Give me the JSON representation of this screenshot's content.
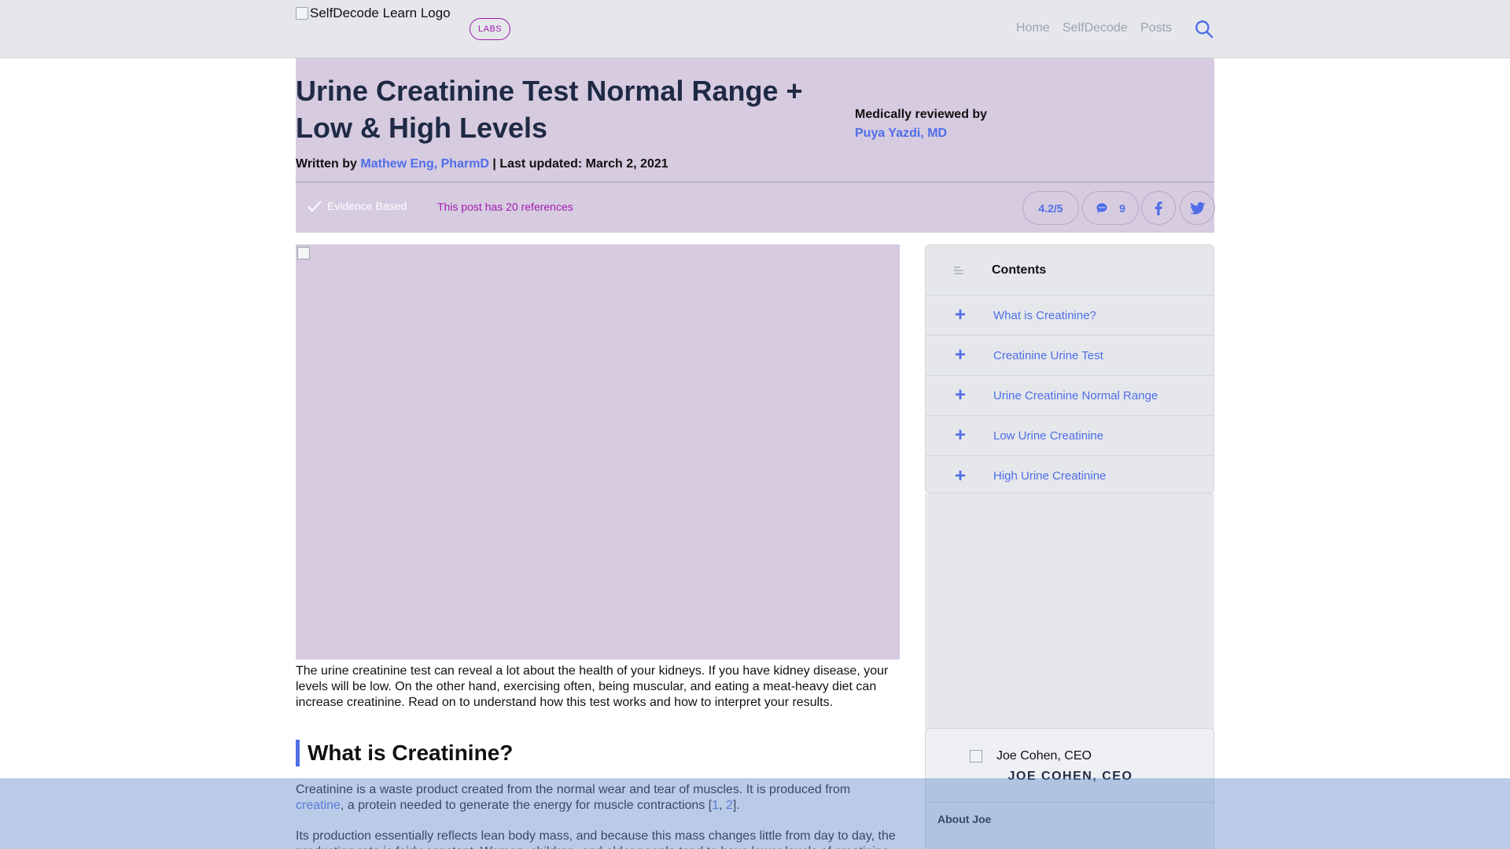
{
  "header": {
    "logo_alt": "SelfDecode Learn Logo",
    "badge": "LABS",
    "nav": [
      "Home",
      "SelfDecode",
      "Posts"
    ]
  },
  "article": {
    "title": "Urine Creatinine Test Normal Range + Low & High Levels",
    "written_by_label": "Written by",
    "author": "Mathew Eng, PharmD",
    "updated": "| Last updated: March 2, 2021",
    "reviewed_label": "Medically reviewed by",
    "reviewer": "Puya Yazdi, MD",
    "evidence": "Evidence Based",
    "references": "This post has 20 references",
    "rating": "4.2/5",
    "comments": "9",
    "intro": "The urine creatinine test can reveal a lot about the health of your kidneys. If you have kidney disease, your levels will be low. On the other hand, exercising often, being muscular, and eating a meat-heavy diet can increase creatinine. Read on to understand how this test works and how to interpret your results.",
    "section_title": "What is Creatinine?",
    "para1_a": "Creatinine is a waste product created from the normal wear and tear of muscles. It is produced from ",
    "para1_link": "creatine",
    "para1_b": ", a protein needed to generate the energy for muscle contractions [",
    "ref1": "1",
    "ref_sep": ", ",
    "ref2": "2",
    "para1_c": "].",
    "para2": "Its production essentially reflects lean body mass, and because this mass changes little from day to day, the production rate is fairly constant. Women, children, and older people tend to have lower levels of creatinine."
  },
  "sidebar": {
    "contents_title": "Contents",
    "toc": [
      "What is Creatinine?",
      "Creatinine Urine Test",
      "Urine Creatinine Normal Range",
      "Low Urine Creatinine",
      "High Urine Creatinine"
    ],
    "author_img_alt": "Joe Cohen, CEO",
    "author_name": "JOE COHEN, CEO",
    "about": "About Joe"
  },
  "colors": {
    "accent": "#4f6ee8",
    "hero_bg": "#d7cbe0",
    "labs": "#a21caf"
  },
  "icons": [
    "search-icon",
    "check-icon",
    "comment-icon",
    "facebook-icon",
    "twitter-icon",
    "list-icon",
    "plus-icon"
  ]
}
